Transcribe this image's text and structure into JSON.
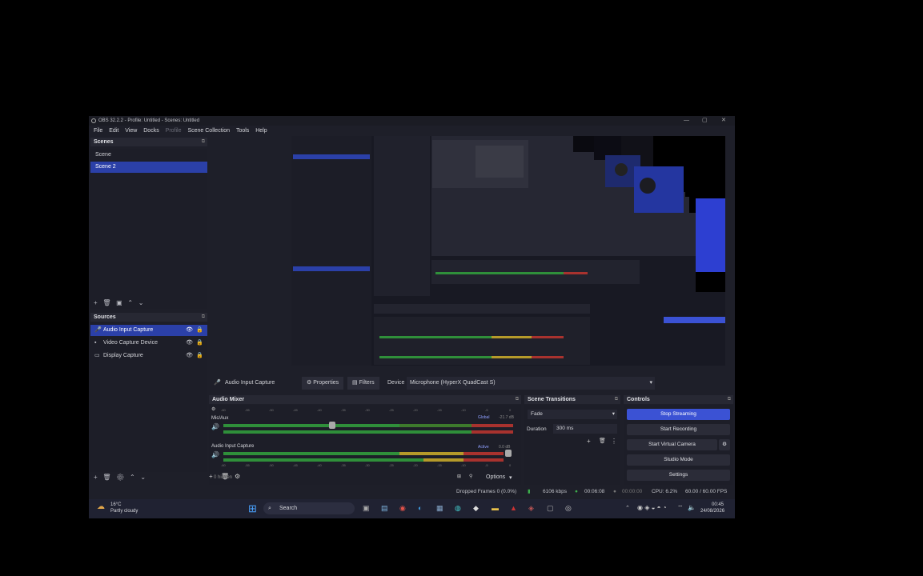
{
  "window": {
    "title": "OBS 32.2.2 - Profile: Untitled - Scenes: Untitled"
  },
  "menu": [
    "File",
    "Edit",
    "View",
    "Docks",
    "Profile",
    "Scene Collection",
    "Tools",
    "Help"
  ],
  "scenes": {
    "header": "Scenes",
    "items": [
      {
        "label": "Scene",
        "selected": false
      },
      {
        "label": "Scene 2",
        "selected": true
      }
    ]
  },
  "sources": {
    "header": "Sources",
    "items": [
      {
        "label": "Audio Input Capture",
        "icon": "microphone-icon",
        "selected": true
      },
      {
        "label": "Video Capture Device",
        "icon": "camera-icon",
        "selected": false
      },
      {
        "label": "Display Capture",
        "icon": "monitor-icon",
        "selected": false
      }
    ]
  },
  "context_bar": {
    "source": "Audio Input Capture",
    "properties": "Properties",
    "filters": "Filters",
    "device_label": "Device",
    "device_value": "Microphone (HyperX QuadCast S)"
  },
  "audio_mixer": {
    "header": "Audio Mixer",
    "channels": [
      {
        "name": "Mic/Aux",
        "tag": "Global",
        "db": "-21.7 dB"
      },
      {
        "name": "Audio Input Capture",
        "tag": "Active",
        "db": "0.0 dB"
      }
    ],
    "ticks": [
      "-60",
      "-55",
      "-50",
      "-45",
      "-40",
      "-35",
      "-30",
      "-25",
      "-20",
      "-15",
      "-10",
      "-5",
      "0"
    ],
    "hidden_count": "0 hidden",
    "options": "Options"
  },
  "scene_transitions": {
    "header": "Scene Transitions",
    "transition": "Fade",
    "duration_label": "Duration",
    "duration_value": "300 ms"
  },
  "controls": {
    "header": "Controls",
    "stop_streaming": "Stop Streaming",
    "start_recording": "Start Recording",
    "start_virtual_camera": "Start Virtual Camera",
    "studio_mode": "Studio Mode",
    "settings": "Settings"
  },
  "status": {
    "dropped_frames": "Dropped Frames 0 (0.0%)",
    "bitrate": "6106 kbps",
    "stream_time": "00:06:08",
    "record_time": "00:00:00",
    "cpu": "CPU: 6.2%",
    "fps": "60.00 / 60.00 FPS"
  },
  "taskbar": {
    "weather_temp": "16°C",
    "weather_desc": "Partly cloudy",
    "search": "Search",
    "time": "00:45",
    "date": "24/08/2026"
  },
  "colors": {
    "accent": "#3b52d4",
    "selected": "#2b40a8",
    "meter_green": "#2f8f3a",
    "meter_yellow": "#b59a2a",
    "meter_red": "#a8322e"
  }
}
